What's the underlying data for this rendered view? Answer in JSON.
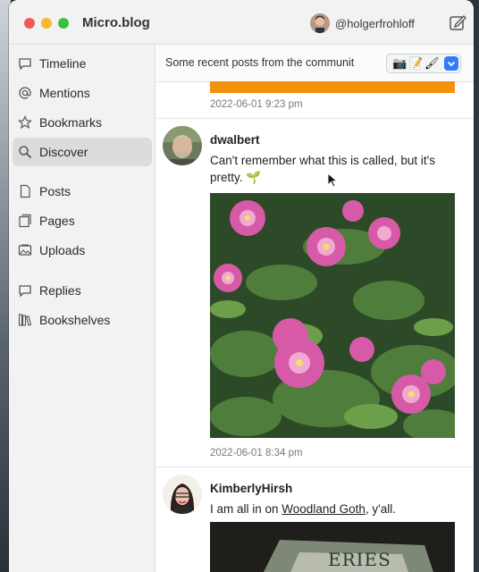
{
  "app": {
    "title": "Micro.blog",
    "username": "@holgerfrohloff"
  },
  "sidebar": {
    "items": [
      {
        "label": "Timeline",
        "icon": "timeline-icon",
        "active": false
      },
      {
        "label": "Mentions",
        "icon": "at-icon",
        "active": false
      },
      {
        "label": "Bookmarks",
        "icon": "star-icon",
        "active": false
      },
      {
        "label": "Discover",
        "icon": "search-icon",
        "active": true
      },
      {
        "label": "Posts",
        "icon": "document-icon",
        "active": false
      },
      {
        "label": "Pages",
        "icon": "pages-icon",
        "active": false
      },
      {
        "label": "Uploads",
        "icon": "photo-icon",
        "active": false
      },
      {
        "label": "Replies",
        "icon": "speech-bubble-icon",
        "active": false
      },
      {
        "label": "Bookshelves",
        "icon": "books-icon",
        "active": false
      }
    ]
  },
  "toolbar": {
    "description": "Some recent posts from the communit",
    "emoji_glyphs": [
      "📷",
      "📝",
      "🖌"
    ]
  },
  "posts": [
    {
      "timestamp": "2022-06-01 9:23 pm"
    },
    {
      "author": "dwalbert",
      "text": "Can't remember what this is called, but it's pretty. 🌱",
      "timestamp": "2022-06-01 8:34 pm"
    },
    {
      "author": "KimberlyHirsh",
      "text_before": "I am all in on ",
      "link": "Woodland Goth",
      "text_after": ", y'all.",
      "image_text": "ERIES"
    }
  ],
  "colors": {
    "accent_orange": "#f5920c",
    "close": "#ee5b53",
    "minimize": "#f4b834",
    "maximize": "#36c144",
    "chevron_blue": "#2f7cf6"
  }
}
